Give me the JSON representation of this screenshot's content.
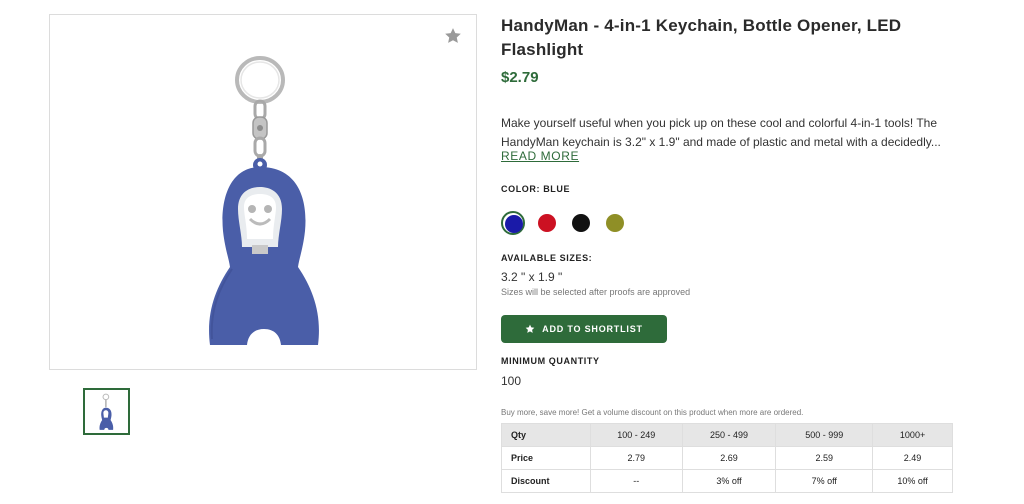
{
  "product": {
    "title": "HandyMan - 4-in-1 Keychain, Bottle Opener, LED Flashlight",
    "price": "$2.79",
    "description": "Make yourself useful when you pick up on these cool and colorful 4-in-1 tools! The HandyMan keychain is 3.2\" x 1.9\" and made of plastic and metal with a decidedly...",
    "read_more": "READ MORE",
    "image_icon": "keychain-bottle-opener-figure",
    "favorite_icon": "star-icon"
  },
  "color": {
    "label": "COLOR: BLUE",
    "swatches": [
      {
        "name": "Blue",
        "hex": "#1a1aa8",
        "selected": true
      },
      {
        "name": "Red",
        "hex": "#cc1122",
        "selected": false
      },
      {
        "name": "Black",
        "hex": "#111111",
        "selected": false
      },
      {
        "name": "Olive",
        "hex": "#8f8f26",
        "selected": false
      }
    ]
  },
  "sizes": {
    "label": "AVAILABLE SIZES:",
    "value": "3.2 \" x 1.9 \"",
    "note": "Sizes will be selected after proofs are approved"
  },
  "shortlist_button": "ADD TO SHORTLIST",
  "minimum": {
    "label": "MINIMUM QUANTITY",
    "value": "100"
  },
  "pricing": {
    "note": "Buy more, save more! Get a volume discount on this product when more are ordered.",
    "headers": [
      "Qty",
      "100 - 249",
      "250 - 499",
      "500 - 999",
      "1000+"
    ],
    "rows": [
      [
        "Price",
        "2.79",
        "2.69",
        "2.59",
        "2.49"
      ],
      [
        "Discount",
        "--",
        "3% off",
        "7% off",
        "10% off"
      ]
    ]
  },
  "colors": {
    "accent": "#2e6b3a",
    "product_blue": "#4a5ea8"
  }
}
